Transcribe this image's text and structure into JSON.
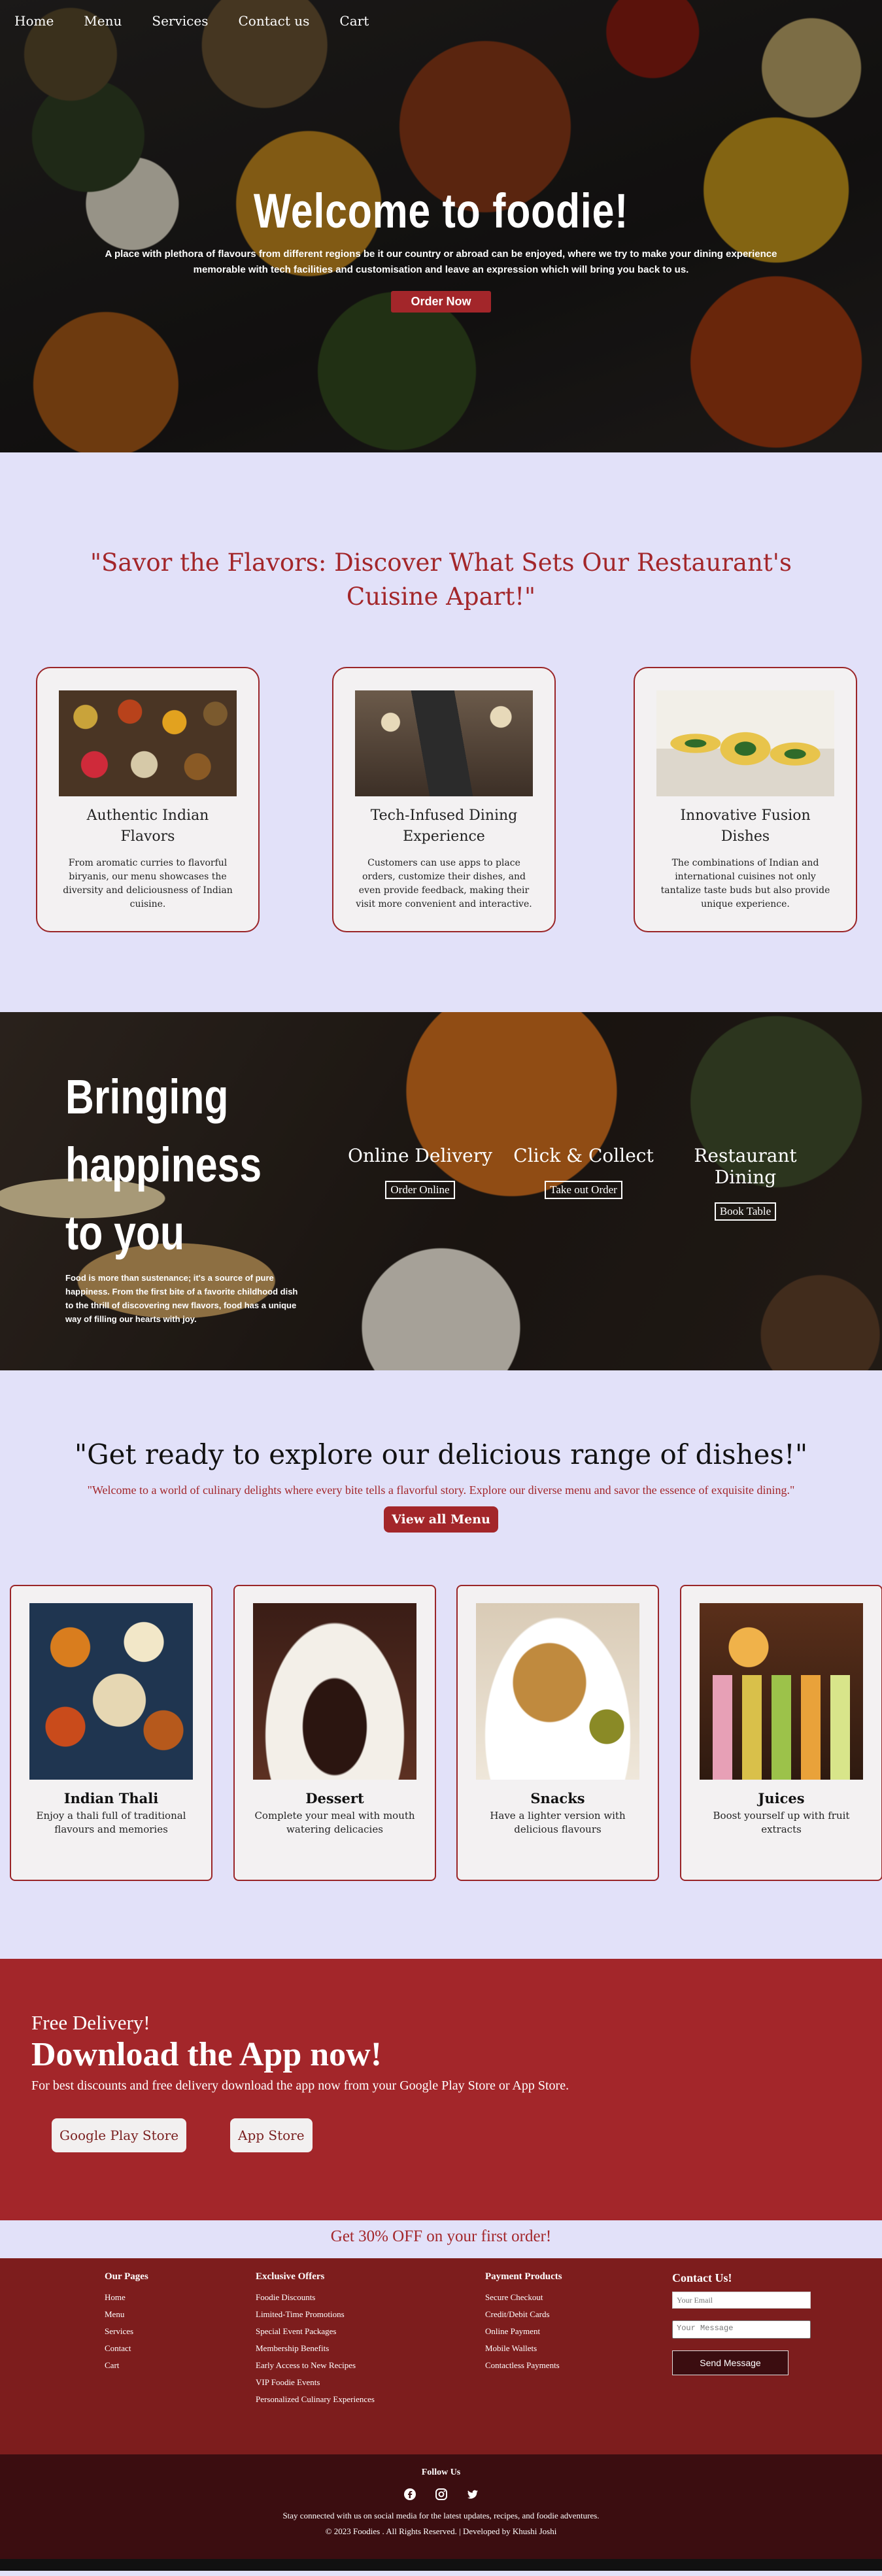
{
  "nav": [
    "Home",
    "Menu",
    "Services",
    "Contact us",
    "Cart"
  ],
  "hero": {
    "title": "Welcome to foodie!",
    "description": "A place with plethora of flavours from different regions be it our country or abroad can be enjoyed, where we try to make your dining experience memorable with tech facilities and customisation and leave an expression which will bring you back to us.",
    "cta": "Order Now"
  },
  "features": {
    "heading": "\"Savor the Flavors: Discover What Sets Our Restaurant's Cuisine Apart!\"",
    "cards": [
      {
        "title": "Authentic Indian Flavors",
        "text": "From aromatic curries to flavorful biryanis, our menu showcases the diversity and deliciousness of Indian cuisine."
      },
      {
        "title": "Tech-Infused Dining Experience",
        "text": "Customers can use apps to place orders, customize their dishes, and even provide feedback, making their visit more convenient and interactive."
      },
      {
        "title": "Innovative Fusion Dishes",
        "text": "The combinations of Indian and international cuisines not only tantalize taste buds but also provide unique experience."
      }
    ]
  },
  "happiness": {
    "title": "Bringing happiness to you",
    "text": "Food is more than sustenance; it's a source of pure happiness. From the first bite of a favorite childhood dish to the thrill of discovering new flavors, food has a unique way of filling our hearts with joy.",
    "services": [
      {
        "title": "Online Delivery",
        "button": "Order Online"
      },
      {
        "title": "Click & Collect",
        "button": "Take out Order"
      },
      {
        "title": "Restaurant Dining",
        "button": "Book Table"
      }
    ]
  },
  "dishes": {
    "heading": "\"Get ready to explore our delicious range of dishes!\"",
    "subtitle": "\"Welcome to a world of culinary delights where every bite tells a flavorful story. Explore our diverse menu and savor the essence of exquisite dining.\"",
    "cta": "View all Menu",
    "cards": [
      {
        "title": "Indian Thali",
        "text": "Enjoy a thali full of traditional flavours and memories"
      },
      {
        "title": "Dessert",
        "text": "Complete your meal with mouth watering delicacies"
      },
      {
        "title": "Snacks",
        "text": "Have a lighter version with delicious flavours"
      },
      {
        "title": "Juices",
        "text": "Boost yourself up with fruit extracts"
      }
    ]
  },
  "app": {
    "free": "Free Delivery!",
    "title": "Download the App now!",
    "desc": "For best discounts and free delivery download the app now from your Google Play Store or App Store.",
    "google": "Google Play Store",
    "apple": "App Store"
  },
  "promo": "Get 30% OFF on your first order!",
  "footer": {
    "pages": {
      "title": "Our Pages",
      "links": [
        "Home",
        "Menu",
        "Services",
        "Contact",
        "Cart"
      ]
    },
    "offers": {
      "title": "Exclusive Offers",
      "links": [
        "Foodie Discounts",
        "Limited-Time Promotions",
        "Special Event Packages",
        "Membership Benefits",
        "Early Access to New Recipes",
        "VIP Foodie Events",
        "Personalized Culinary Experiences"
      ]
    },
    "payment": {
      "title": "Payment Products",
      "links": [
        "Secure Checkout",
        "Credit/Debit Cards",
        "Online Payment",
        "Mobile Wallets",
        "Contactless Payments"
      ]
    },
    "contact": {
      "title": "Contact Us!",
      "email_placeholder": "Your Email",
      "message_placeholder": "Your Message",
      "send": "Send Message"
    },
    "follow": "Follow Us",
    "social_icons": [
      "facebook-icon",
      "instagram-icon",
      "twitter-icon"
    ],
    "tagline": "Stay connected with us on social media for the latest updates, recipes, and foodie adventures.",
    "copyright": "© 2023 Foodies . All Rights Reserved. | Developed by Khushi Joshi"
  },
  "colors": {
    "accent": "#a3262a",
    "background": "#e2e1f9",
    "footer": "#7d1d1d",
    "footer_bottom": "#3b0d10"
  }
}
